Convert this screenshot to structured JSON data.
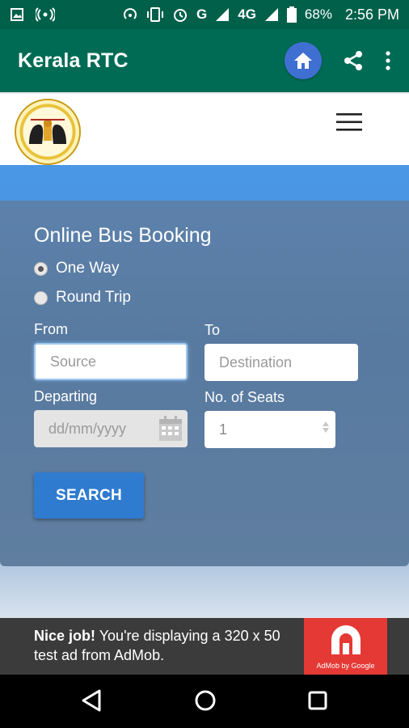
{
  "status_bar": {
    "battery": "68%",
    "time": "2:56 PM",
    "network": "G",
    "network2": "4G",
    "icons": [
      "image-icon",
      "radio-icon",
      "hotspot-icon",
      "vibrate-icon",
      "alarm-icon",
      "signal-icon",
      "battery-icon"
    ]
  },
  "app_bar": {
    "title": "Kerala RTC",
    "icons": [
      "home-icon",
      "share-icon",
      "more-vert-icon"
    ]
  },
  "header": {
    "logo": "kerala-rtc-logo",
    "menu_icon": "hamburger-icon"
  },
  "form": {
    "title": "Online Bus Booking",
    "trip_options": [
      {
        "label": "One Way",
        "checked": true
      },
      {
        "label": "Round Trip",
        "checked": false
      }
    ],
    "from_label": "From",
    "to_label": "To",
    "source_placeholder": "Source",
    "destination_placeholder": "Destination",
    "departing_label": "Departing",
    "date_placeholder": "dd/mm/yyyy",
    "seats_label": "No. of Seats",
    "seats_value": "1",
    "search_label": "SEARCH"
  },
  "ad": {
    "bold_text": "Nice job!",
    "text": " You're displaying a 320 x 50 test ad from AdMob.",
    "brand_caption": "AdMob by Google"
  },
  "nav_bar": {
    "icons": [
      "back-icon",
      "home-circle-icon",
      "recents-icon"
    ]
  },
  "colors": {
    "status_bar": "#00604a",
    "app_bar": "#006b54",
    "home_button": "#3f6fd1",
    "search_button": "#2f7bd0",
    "admob": "#e53935"
  }
}
